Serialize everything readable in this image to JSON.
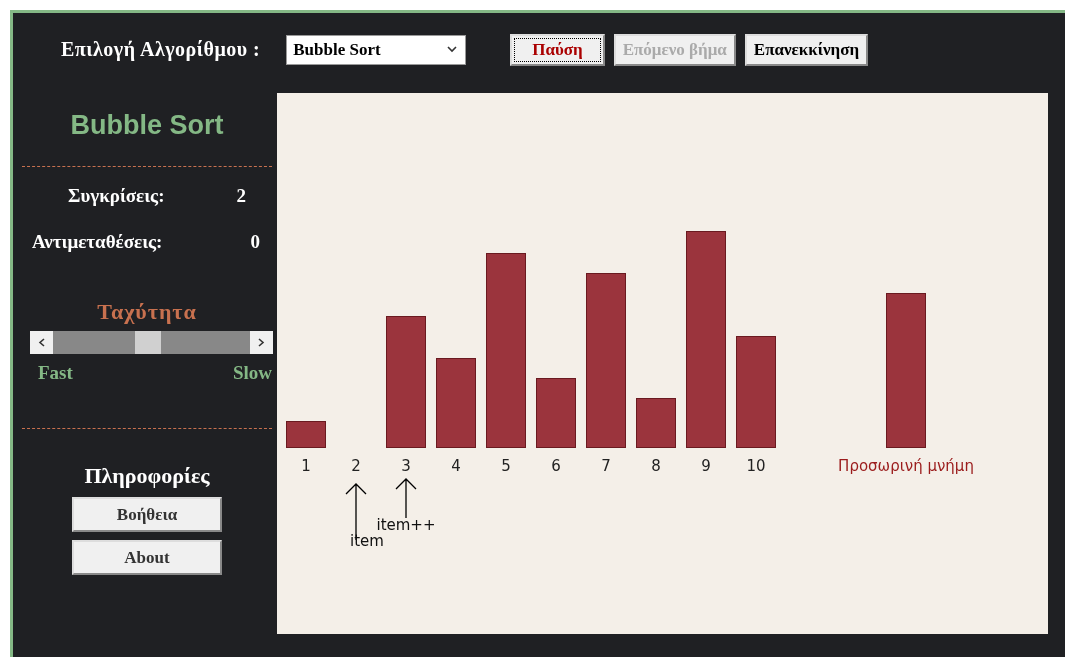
{
  "header": {
    "label": "Επιλογή Αλγορίθμου :",
    "algorithm": "Bubble Sort",
    "buttons": [
      {
        "label": "Παύση",
        "kind": "primary",
        "disabled": false
      },
      {
        "label": "Επόμενο βήμα",
        "kind": "normal",
        "disabled": true
      },
      {
        "label": "Επανεκκίνηση",
        "kind": "normal",
        "disabled": false
      }
    ]
  },
  "sidebar": {
    "title": "Bubble Sort",
    "stats": [
      {
        "label": "Συγκρίσεις:",
        "value": "2"
      },
      {
        "label": "Αντιμεταθέσεις:",
        "value": "0"
      }
    ],
    "speed": {
      "title": "Ταχύτητα",
      "level": 0.48,
      "left_label": "Fast",
      "right_label": "Slow"
    },
    "info": {
      "title": "Πληροφορίες",
      "buttons": [
        "Βοήθεια",
        "About"
      ]
    }
  },
  "bars": [
    {
      "label": "1",
      "level": 0.11
    },
    {
      "label": "2",
      "pointer": "item"
    },
    {
      "label": "3",
      "level": 0.53,
      "pointer": "item++"
    },
    {
      "label": "4",
      "level": 0.36
    },
    {
      "label": "5",
      "level": 0.78
    },
    {
      "label": "6",
      "level": 0.28
    },
    {
      "label": "7",
      "level": 0.7
    },
    {
      "label": "8",
      "level": 0.2
    },
    {
      "label": "9",
      "level": 0.87
    },
    {
      "label": "10",
      "level": 0.45
    }
  ],
  "temp": {
    "label": "Προσωρινή μνήμη",
    "level": 0.62
  }
}
